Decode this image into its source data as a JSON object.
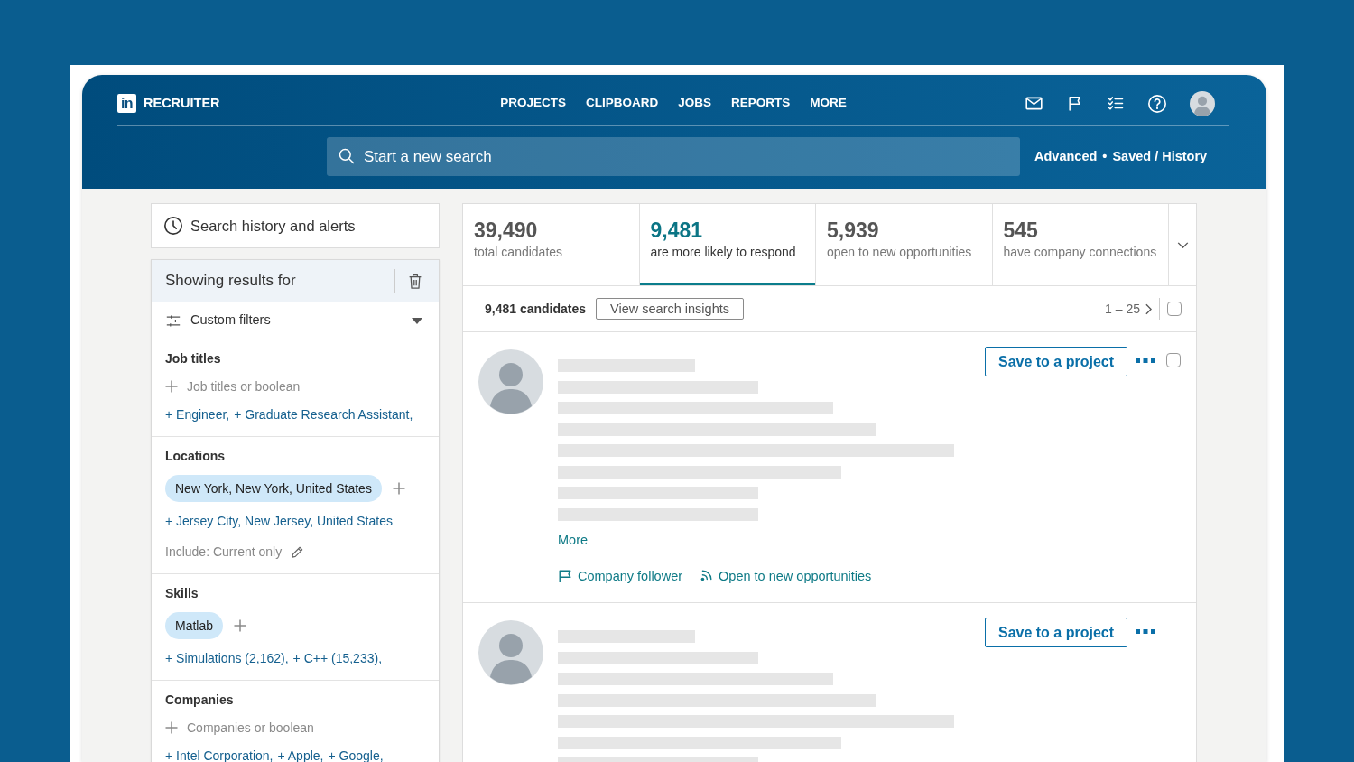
{
  "logo": {
    "mark": "in",
    "product": "RECRUITER"
  },
  "nav": [
    "PROJECTS",
    "CLIPBOARD",
    "JOBS",
    "REPORTS",
    "MORE"
  ],
  "search": {
    "placeholder": "Start a new search",
    "links": [
      "Advanced",
      "Saved / History"
    ],
    "separator": "•"
  },
  "sidebar": {
    "history_button": "Search history and alerts",
    "filters": {
      "title": "Showing results for",
      "mode": "Custom filters",
      "sections": [
        {
          "title": "Job titles",
          "placeholder": "Job titles or boolean",
          "suggestions": [
            "+ Engineer,",
            "+ Graduate Research Assistant,"
          ]
        },
        {
          "title": "Locations",
          "chips": [
            "New York, New York, United States"
          ],
          "suggestions": [
            "+ Jersey City, New Jersey, United States"
          ],
          "note": "Include: Current only"
        },
        {
          "title": "Skills",
          "chips": [
            "Matlab"
          ],
          "suggestions": [
            "+ Simulations (2,162),",
            "+ C++ (15,233),"
          ]
        },
        {
          "title": "Companies",
          "placeholder": "Companies or boolean",
          "suggestions": [
            "+ Intel Corporation,",
            "+ Apple,",
            "+ Google,"
          ]
        }
      ]
    }
  },
  "stats": [
    {
      "value": "39,490",
      "label": "total candidates",
      "selected": false
    },
    {
      "value": "9,481",
      "label": "are more likely to respond",
      "selected": true
    },
    {
      "value": "5,939",
      "label": "open to new opportunities",
      "selected": false
    },
    {
      "value": "545",
      "label": "have company connections",
      "selected": false
    }
  ],
  "results_bar": {
    "count": "9,481 candidates",
    "insights_button": "View search insights",
    "range": "1 – 25",
    "select_all": {
      "checked": false
    }
  },
  "candidates": [
    {
      "save_button": "Save to a project",
      "checkbox": {
        "checked": false
      },
      "more_link": "More",
      "tags": [
        {
          "kind": "follower",
          "label": "Company follower"
        },
        {
          "kind": "open",
          "label": "Open to new opportunities"
        }
      ]
    },
    {
      "save_button": "Save to a project"
    }
  ]
}
